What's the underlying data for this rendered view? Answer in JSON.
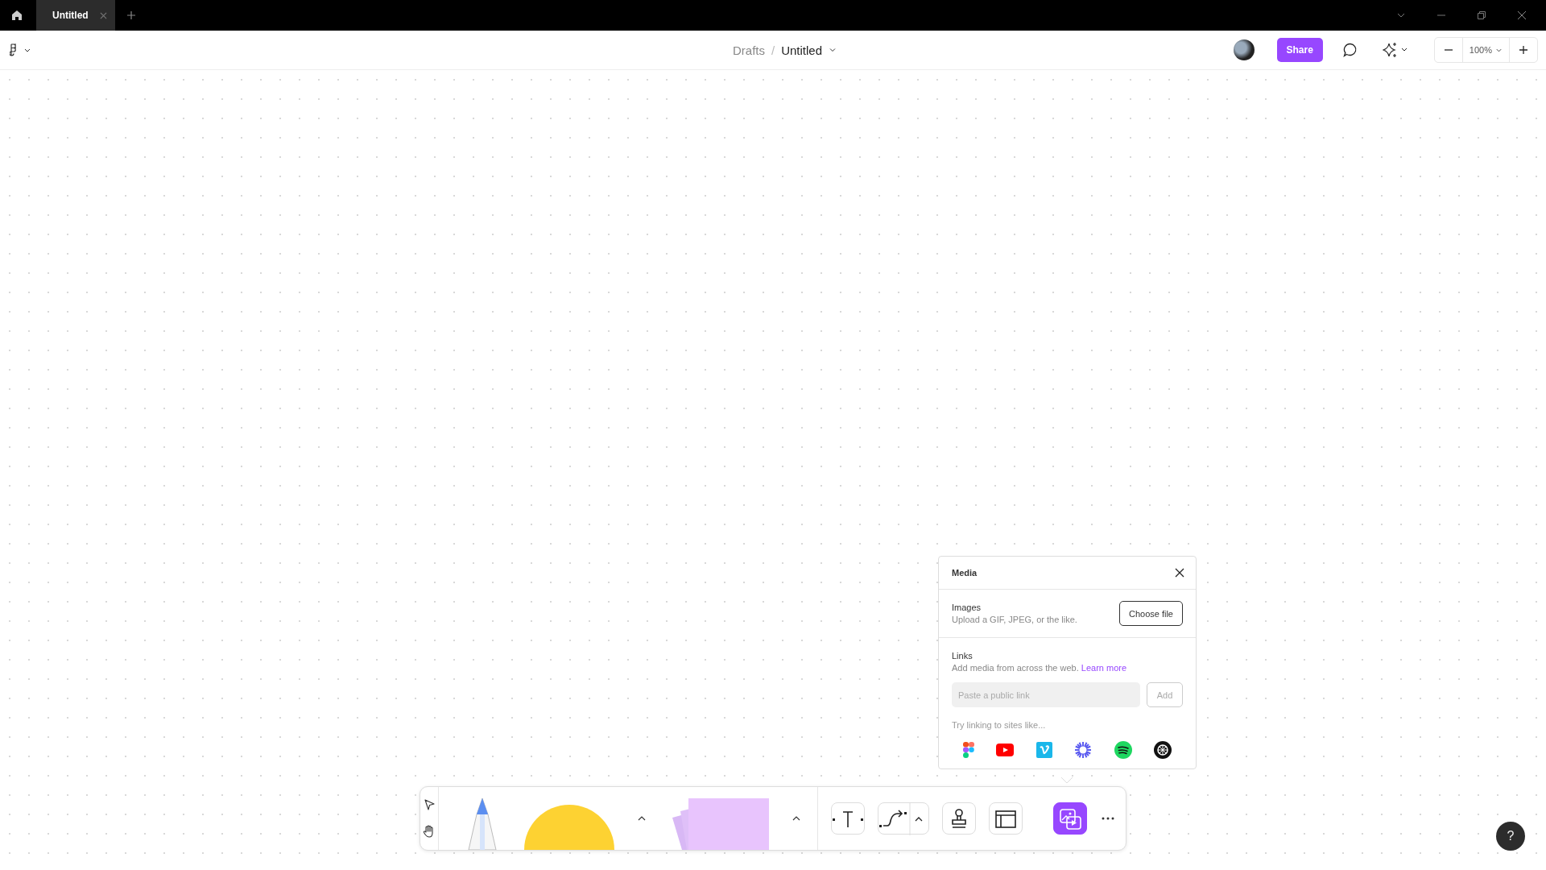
{
  "titlebar": {
    "tabs": [
      {
        "label": "Untitled",
        "selected": true
      }
    ]
  },
  "header": {
    "breadcrumb": {
      "parent": "Drafts",
      "separator": "/",
      "current": "Untitled"
    },
    "share": "Share",
    "zoom": "100%"
  },
  "media_panel": {
    "title": "Media",
    "images": {
      "label": "Images",
      "description": "Upload a GIF, JPEG, or the like.",
      "button": "Choose file"
    },
    "links": {
      "label": "Links",
      "description": "Add media from across the web.",
      "link": "Learn more",
      "placeholder": "Paste a public link",
      "button": "Add",
      "hint": "Try linking to sites like..."
    }
  },
  "toolbar": {
    "tools": [
      {
        "kind": "text",
        "selected": false
      },
      {
        "kind": "connector",
        "selected": false
      },
      {
        "kind": "stamp",
        "selected": false
      },
      {
        "kind": "section",
        "selected": false
      },
      {
        "kind": "media",
        "selected": true
      }
    ]
  },
  "help": "?"
}
